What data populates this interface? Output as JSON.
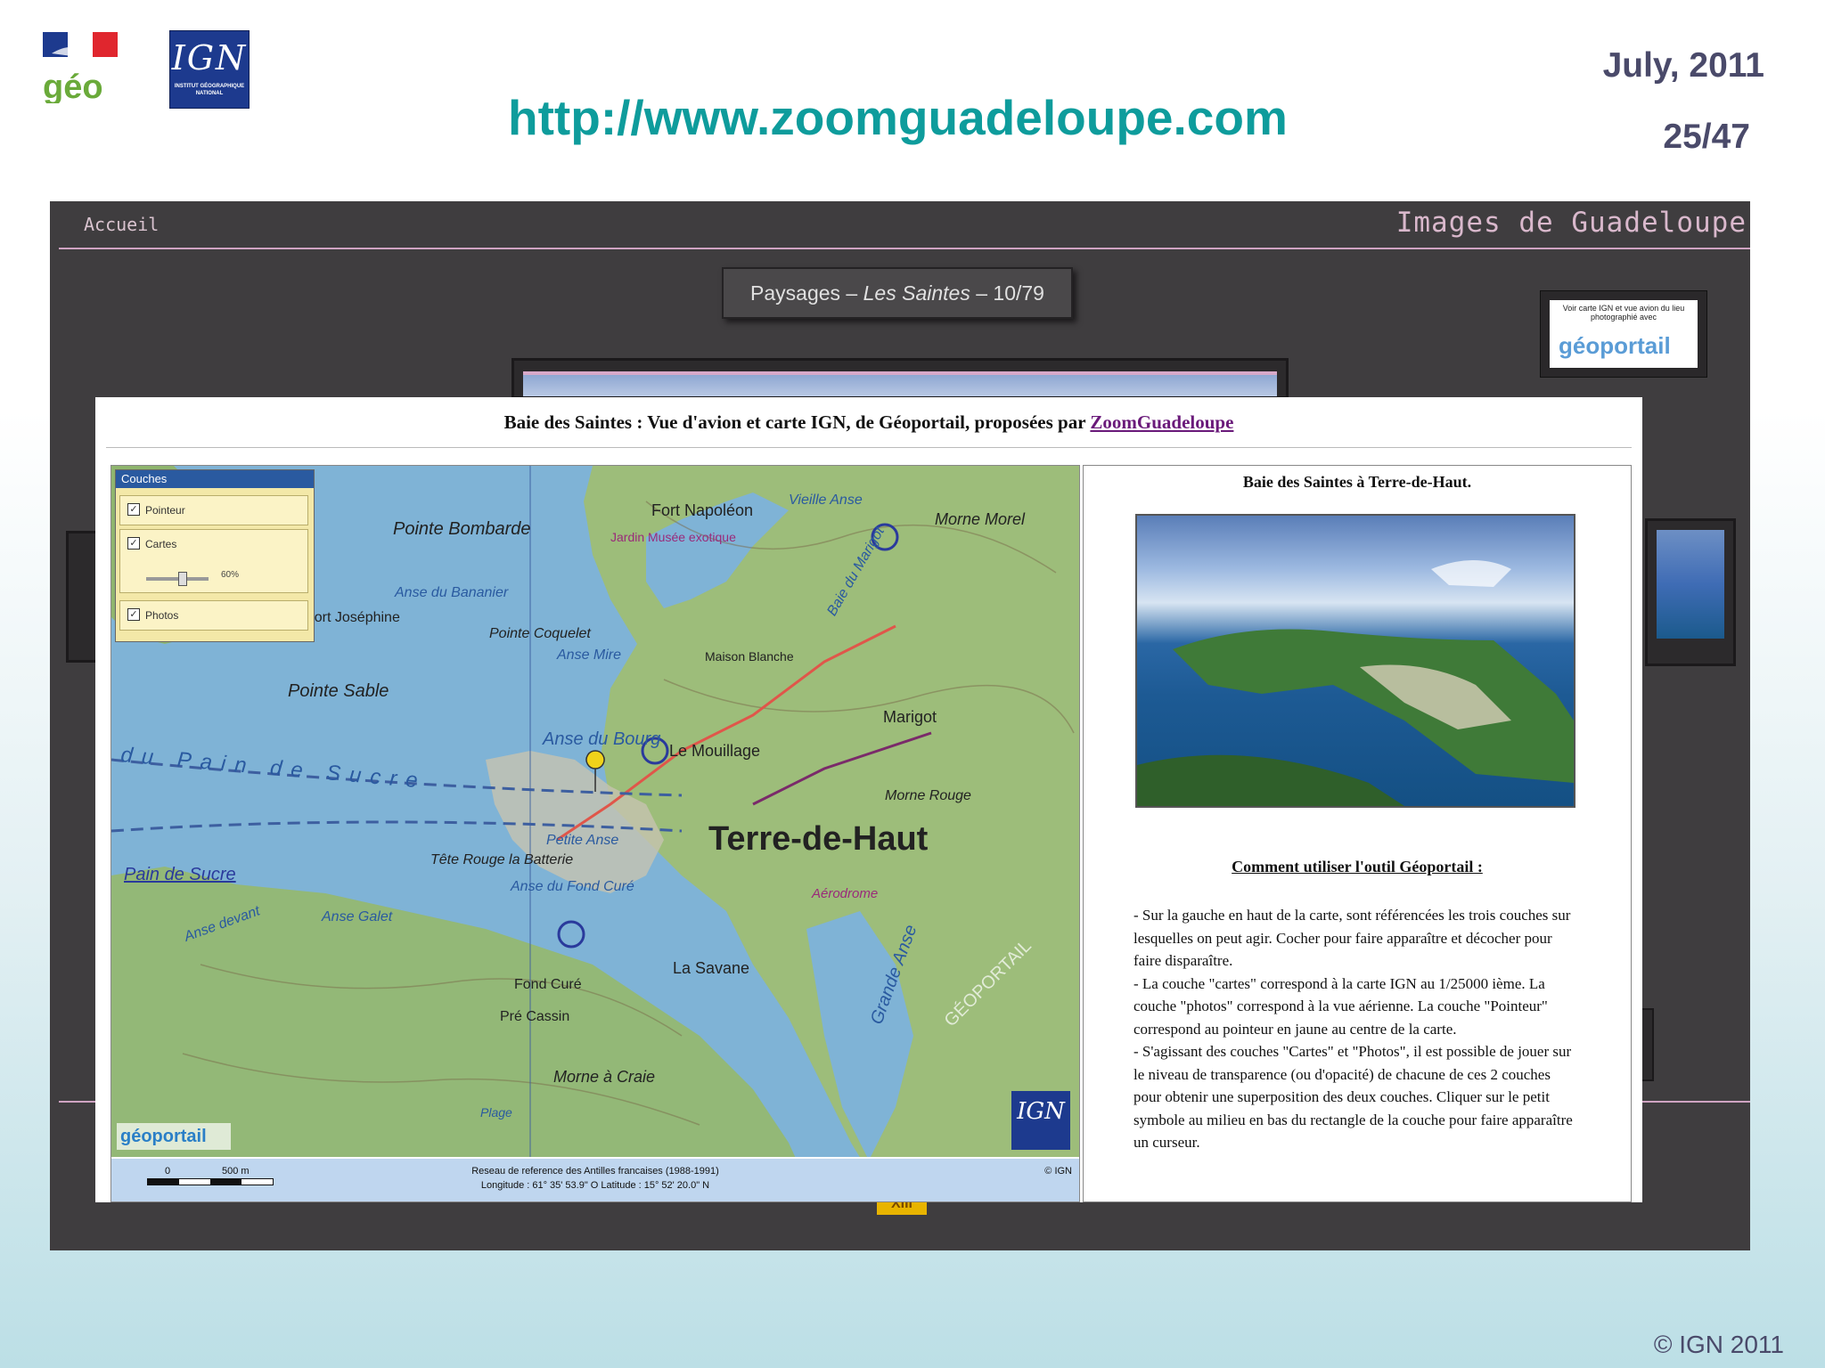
{
  "slide": {
    "url": "http://www.zoomguadeloupe.com",
    "date": "July,  2011",
    "page": "25/47",
    "copyright": "© IGN 2011",
    "logo_geo": "géo",
    "logo_ign": "IGN",
    "logo_ign_sub": "INSTITUT GÉOGRAPHIQUE NATIONAL"
  },
  "site": {
    "home_link": "Accueil",
    "title": "Images de Guadeloupe",
    "caption_prefix": "Paysages – ",
    "caption_italic": "Les Saintes",
    "caption_suffix": " – 10/79",
    "geoportail_button_text": "Voir carte IGN et vue avion du lieu photographié avec",
    "geoportail_button_logo": "géoportail",
    "yellow_tag": "XIII"
  },
  "popup": {
    "title_prefix": "Baie des Saintes : Vue d'avion et carte IGN, de Géoportail, proposées par ",
    "title_link": "ZoomGuadeloupe",
    "map": {
      "layers_panel_title": "Couches",
      "layers": [
        "Pointeur",
        "Cartes",
        "Photos"
      ],
      "opacity_value": "60%",
      "labels": [
        "Fort Napoléon",
        "Vieille Anse",
        "Baie du Marigot",
        "Morne Morel",
        "Pointe Bombarde",
        "Fort Joséphine",
        "Anse du Bananier",
        "Jardin Musée exotique",
        "Pointe Coquelet",
        "Anse Mire",
        "Maison Blanche",
        "Pointe Sable",
        "Anse du Bourg",
        "Le Mouillage",
        "Marigot",
        "Pain de Sucre",
        "Terre-de-Haut",
        "Morne Rouge",
        "Petite Anse",
        "Tête Rouge la Batterie",
        "Anse du Fond Curé",
        "Aérodrome",
        "Anse Galet",
        "Anse devant",
        "Fond Curé",
        "Pré Cassin",
        "La Savane",
        "Grande Anse",
        "Morne à Craie",
        "Plage",
        "GÉOPORTAIL"
      ],
      "sea_label": "du  Pain  de  Sucre",
      "geoportail_logo": "géoportail",
      "ign_logo": "IGN",
      "scale_left": "0",
      "scale_right": "500 m",
      "footer_reference": "Reseau de reference des Antilles francaises (1988-1991)",
      "footer_coords": "Longitude : 61° 35' 53.9\" O  Latitude : 15° 52' 20.0\" N",
      "footer_ign": "© IGN"
    },
    "info": {
      "title": "Baie des Saintes à Terre-de-Haut.",
      "how_title": "Comment utiliser l'outil Géoportail :",
      "paragraphs": [
        "- Sur la gauche en haut de la carte, sont référencées les trois couches sur lesquelles on peut agir. Cocher pour faire apparaître et décocher pour faire disparaître.",
        "- La couche \"cartes\" correspond à la carte IGN au 1/25000 ième. La couche \"photos\" correspond à la vue aérienne. La couche \"Pointeur\" correspond au pointeur en jaune au centre de la carte.",
        "- S'agissant des couches \"Cartes\" et \"Photos\", il est possible de jouer sur le niveau de transparence (ou d'opacité) de chacune de ces 2 couches pour obtenir une superposition des deux couches. Cliquer sur le petit symbole au milieu en bas du rectangle de la couche pour faire apparaître un curseur."
      ]
    }
  }
}
